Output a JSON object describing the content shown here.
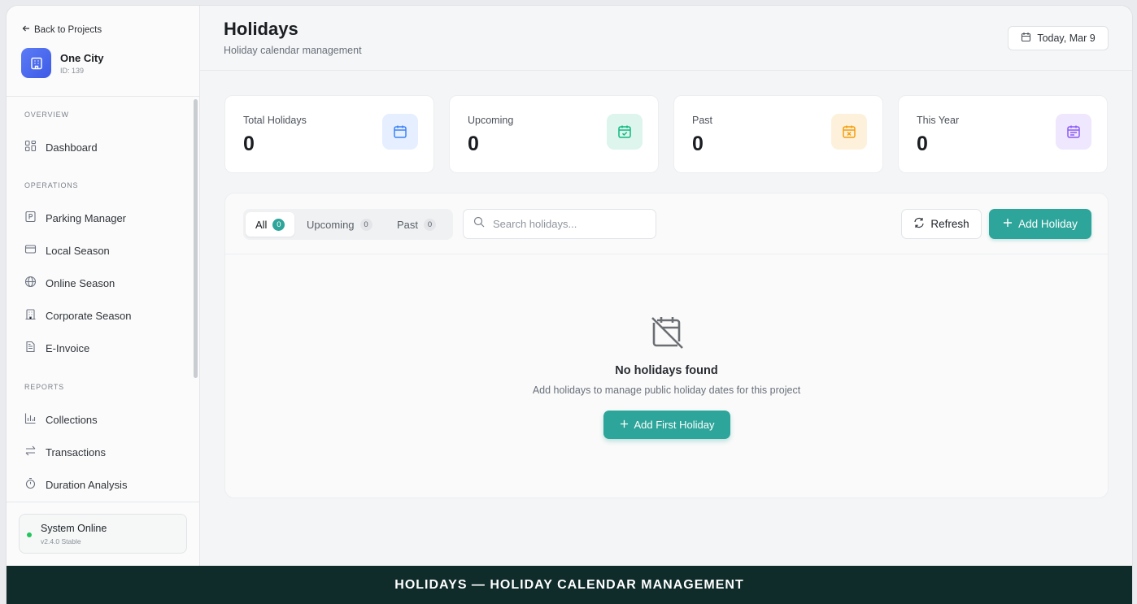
{
  "sidebar": {
    "back_label": "Back to Projects",
    "project": {
      "name": "One City",
      "id": "ID: 139"
    },
    "sections": [
      {
        "title": "OVERVIEW",
        "items": [
          {
            "label": "Dashboard",
            "icon": "grid-icon"
          }
        ]
      },
      {
        "title": "OPERATIONS",
        "items": [
          {
            "label": "Parking Manager",
            "icon": "parking-icon"
          },
          {
            "label": "Local Season",
            "icon": "card-icon"
          },
          {
            "label": "Online Season",
            "icon": "globe-icon"
          },
          {
            "label": "Corporate Season",
            "icon": "building-icon"
          },
          {
            "label": "E-Invoice",
            "icon": "document-icon"
          }
        ]
      },
      {
        "title": "REPORTS",
        "items": [
          {
            "label": "Collections",
            "icon": "bar-chart-icon"
          },
          {
            "label": "Transactions",
            "icon": "arrows-icon"
          },
          {
            "label": "Duration Analysis",
            "icon": "stopwatch-icon"
          }
        ]
      }
    ],
    "status": {
      "title": "System Online",
      "version": "v2.4.0 Stable",
      "color": "#22c55e"
    }
  },
  "header": {
    "title": "Holidays",
    "subtitle": "Holiday calendar management",
    "today_label": "Today, Mar 9"
  },
  "stats": [
    {
      "label": "Total Holidays",
      "value": "0",
      "icon": "calendar-icon",
      "color": "#3b82f6"
    },
    {
      "label": "Upcoming",
      "value": "0",
      "icon": "calendar-check-icon",
      "color": "#10b981"
    },
    {
      "label": "Past",
      "value": "0",
      "icon": "calendar-x-icon",
      "color": "#f59e0b"
    },
    {
      "label": "This Year",
      "value": "0",
      "icon": "calendar-range-icon",
      "color": "#8b5cf6"
    }
  ],
  "panel": {
    "tabs": [
      {
        "label": "All",
        "count": "0",
        "active": true
      },
      {
        "label": "Upcoming",
        "count": "0",
        "active": false
      },
      {
        "label": "Past",
        "count": "0",
        "active": false
      }
    ],
    "search_placeholder": "Search holidays...",
    "refresh_label": "Refresh",
    "add_label": "Add Holiday",
    "empty": {
      "title": "No holidays found",
      "subtitle": "Add holidays to manage public holiday dates for this project",
      "button_label": "Add First Holiday"
    },
    "accent": "#2ea59a"
  },
  "banner": {
    "text": "HOLIDAYS — HOLIDAY CALENDAR MANAGEMENT"
  }
}
